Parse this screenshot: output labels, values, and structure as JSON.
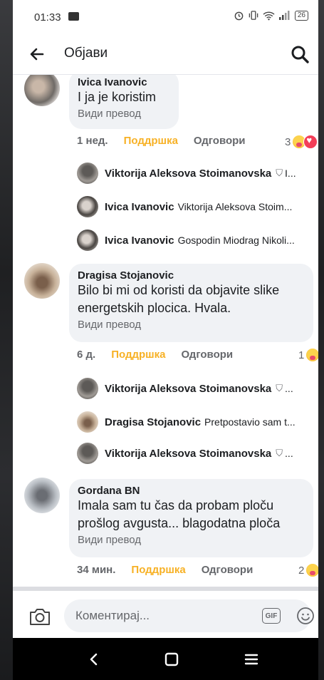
{
  "status": {
    "time": "01:33",
    "battery": "26"
  },
  "appbar": {
    "title": "Објави"
  },
  "comments": [
    {
      "author": "Ivica Ivanovic",
      "lines": [
        "I ja je koristim"
      ],
      "translate": "Види превод",
      "time": "1 нед.",
      "like": "Поддршка",
      "reply": "Одговори",
      "reactions": "3"
    },
    {
      "author": "Dragisa Stojanovic",
      "lines": [
        "Bilo bi mi od koristi da objavite slike",
        "energetskih plocica. Hvala."
      ],
      "translate": "Види превод",
      "time": "6 д.",
      "like": "Поддршка",
      "reply": "Одговори",
      "reactions": "1"
    },
    {
      "author": "Gordana BN",
      "lines": [
        "Imala sam tu čas  da probam ploču",
        "prošlog avgusta... blagodatna ploča"
      ],
      "translate": "Види превод",
      "time": "34 мин.",
      "like": "Поддршка",
      "reply": "Одговори",
      "reactions": "2"
    }
  ],
  "replies": [
    {
      "name": "Viktorija Aleksova Stoimanovska",
      "text": "",
      "tail": "I..."
    },
    {
      "name": "Ivica Ivanovic",
      "text": "Viktorija Aleksova Stoim...",
      "tail": ""
    },
    {
      "name": "Ivica Ivanovic",
      "text": "Gospodin Miodrag Nikoli...",
      "tail": ""
    },
    {
      "name": "Viktorija Aleksova Stoimanovska",
      "text": "",
      "tail": "..."
    },
    {
      "name": "Dragisa Stojanovic",
      "text": "Pretpostavio sam t...",
      "tail": ""
    },
    {
      "name": "Viktorija Aleksova Stoimanovska",
      "text": "",
      "tail": "..."
    }
  ],
  "composer": {
    "placeholder": "Коментирај...",
    "gif": "GIF"
  },
  "icons": {
    "back": "arrow-left-icon",
    "search": "search-icon",
    "camera": "camera-icon",
    "gif": "gif-icon",
    "emoji": "smile-icon",
    "shield": "shield-icon",
    "nav_back": "chevron-left-icon",
    "nav_home": "home-square-icon",
    "nav_recent": "menu-lines-icon"
  },
  "colors": {
    "like": "#f7b125",
    "bubble": "#f0f2f5",
    "secondary_text": "#65676b",
    "heart": "#f33e58"
  }
}
